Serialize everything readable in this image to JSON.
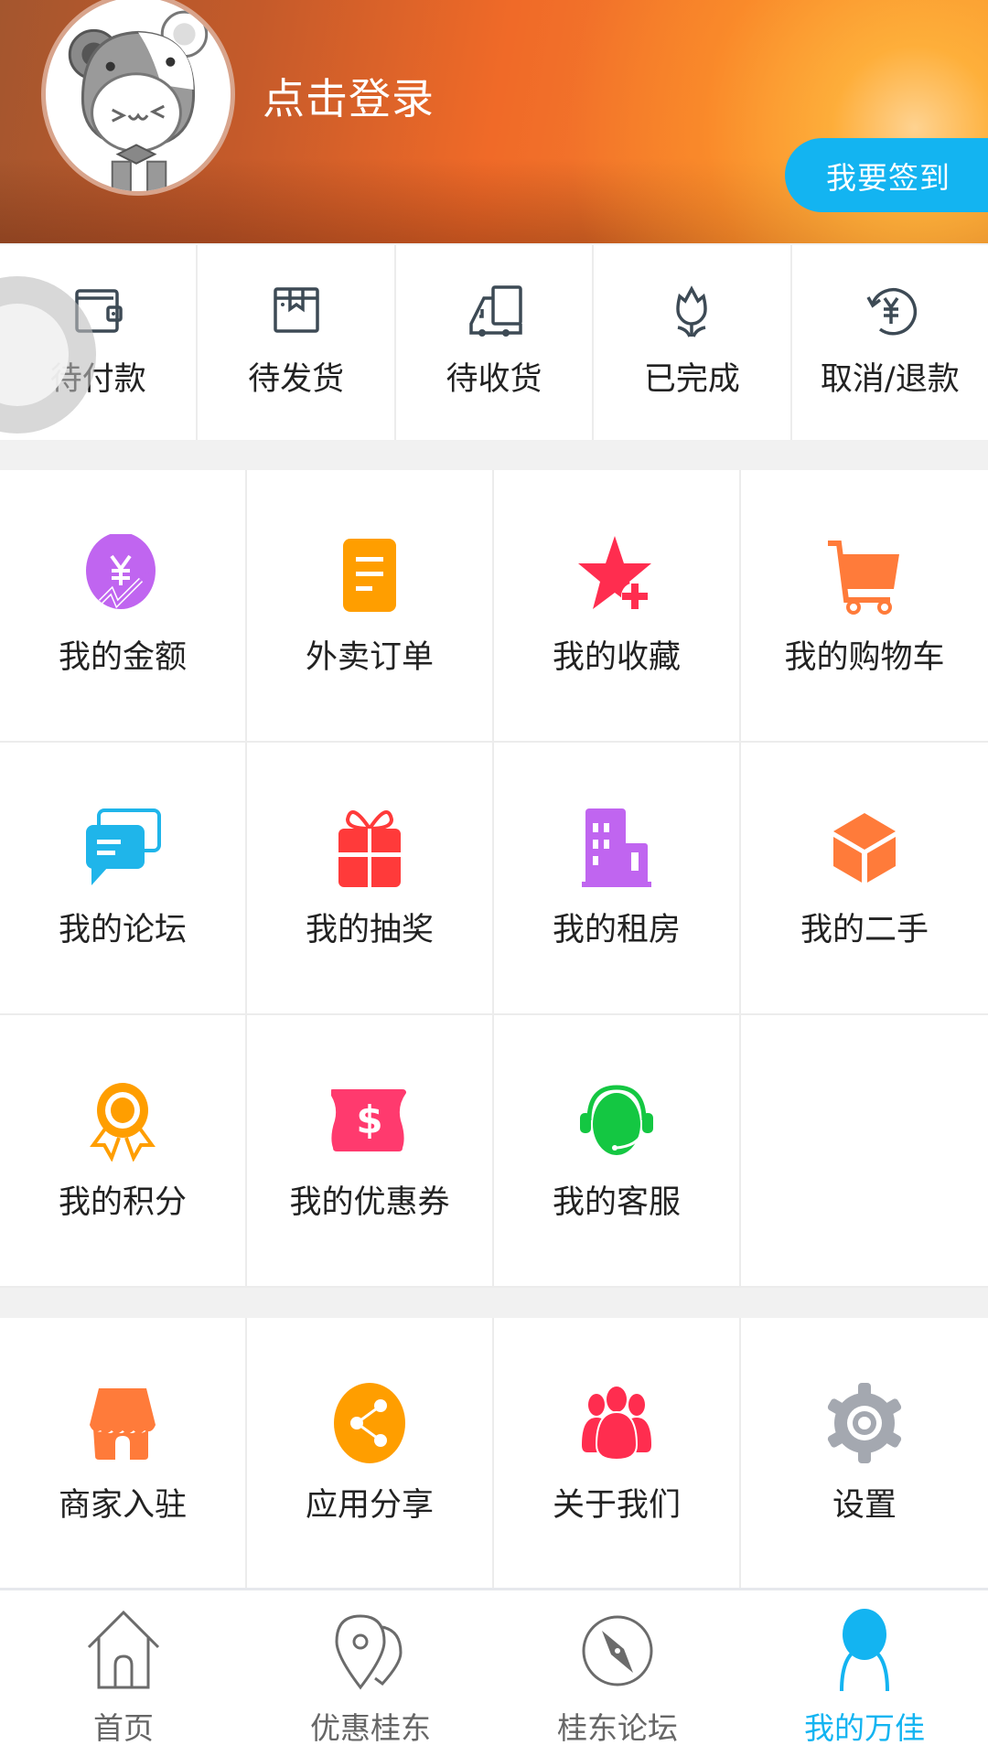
{
  "header": {
    "login_text": "点击登录",
    "signin_button": "我要签到",
    "signin_color": "#13b4f1"
  },
  "orders": [
    {
      "label": "待付款",
      "icon": "wallet-icon"
    },
    {
      "label": "待发货",
      "icon": "package-icon"
    },
    {
      "label": "待收货",
      "icon": "truck-icon"
    },
    {
      "label": "已完成",
      "icon": "tulip-icon"
    },
    {
      "label": "取消/退款",
      "icon": "refund-icon"
    }
  ],
  "menu_grid": [
    {
      "label": "我的金额",
      "icon": "money-growth-icon",
      "color": "#c065f0"
    },
    {
      "label": "外卖订单",
      "icon": "order-list-icon",
      "color": "#ff9e00"
    },
    {
      "label": "我的收藏",
      "icon": "star-add-icon",
      "color": "#ff2d4f"
    },
    {
      "label": "我的购物车",
      "icon": "cart-icon",
      "color": "#ff7b3a"
    },
    {
      "label": "我的论坛",
      "icon": "chat-bubbles-icon",
      "color": "#1fb5ea"
    },
    {
      "label": "我的抽奖",
      "icon": "gift-icon",
      "color": "#ff3a3a"
    },
    {
      "label": "我的租房",
      "icon": "building-icon",
      "color": "#c065f0"
    },
    {
      "label": "我的二手",
      "icon": "box-icon",
      "color": "#ff7b3a"
    },
    {
      "label": "我的积分",
      "icon": "medal-icon",
      "color": "#ff9e00"
    },
    {
      "label": "我的优惠券",
      "icon": "coupon-icon",
      "color": "#ff3a6e"
    },
    {
      "label": "我的客服",
      "icon": "headset-icon",
      "color": "#14c742"
    },
    {
      "label": "",
      "icon": ""
    }
  ],
  "extra_grid": [
    {
      "label": "商家入驻",
      "icon": "shop-icon",
      "color": "#ff7b3a"
    },
    {
      "label": "应用分享",
      "icon": "share-icon",
      "color": "#ff9e00"
    },
    {
      "label": "关于我们",
      "icon": "group-icon",
      "color": "#ff2d4f"
    },
    {
      "label": "设置",
      "icon": "gear-icon",
      "color": "#a4a8b0"
    }
  ],
  "tabbar": {
    "items": [
      {
        "label": "首页",
        "icon": "home-icon",
        "active": false
      },
      {
        "label": "优惠桂东",
        "icon": "location-pins-icon",
        "active": false
      },
      {
        "label": "桂东论坛",
        "icon": "compass-icon",
        "active": false
      },
      {
        "label": "我的万佳",
        "icon": "user-icon",
        "active": true
      }
    ],
    "active_color": "#13b4f1"
  }
}
